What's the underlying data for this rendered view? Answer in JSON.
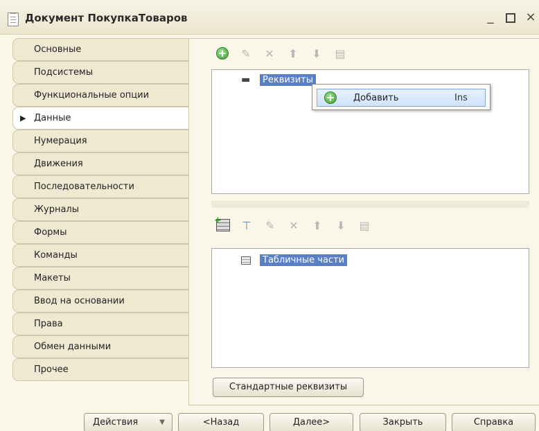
{
  "window": {
    "title": "Документ ПокупкаТоваров",
    "minimize": "_",
    "close": "×"
  },
  "nav": {
    "items": [
      {
        "label": "Основные"
      },
      {
        "label": "Подсистемы"
      },
      {
        "label": "Функциональные опции"
      },
      {
        "label": "Данные",
        "active": true
      },
      {
        "label": "Нумерация"
      },
      {
        "label": "Движения"
      },
      {
        "label": "Последовательности"
      },
      {
        "label": "Журналы"
      },
      {
        "label": "Формы"
      },
      {
        "label": "Команды"
      },
      {
        "label": "Макеты"
      },
      {
        "label": "Ввод на основании"
      },
      {
        "label": "Права"
      },
      {
        "label": "Обмен данными"
      },
      {
        "label": "Прочее"
      }
    ]
  },
  "attributes_tree": {
    "root_label": "Реквизиты"
  },
  "context_menu": {
    "item_label": "Добавить",
    "item_shortcut": "Ins"
  },
  "tabular_tree": {
    "root_label": "Табличные части"
  },
  "buttons": {
    "standard_attributes": "Стандартные реквизиты",
    "actions": "Действия",
    "back": "<Назад",
    "next": "Далее>",
    "close": "Закрыть",
    "help": "Справка"
  },
  "colors": {
    "selection": "#5b7fc7",
    "background": "#fbf7e8"
  }
}
